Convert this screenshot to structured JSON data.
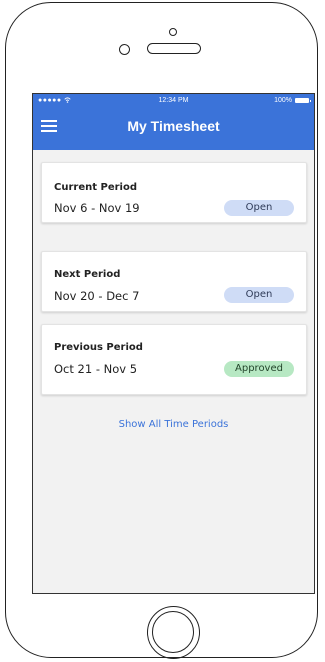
{
  "status_bar": {
    "signal": "●●●●● ",
    "wifi_icon": "wifi-icon",
    "time": "12:34 PM",
    "battery_percent": "100%"
  },
  "app_bar": {
    "menu_icon": "hamburger-menu-icon",
    "title": "My Timesheet"
  },
  "periods": [
    {
      "label": "Current Period",
      "dates": "Nov 6 - Nov 19",
      "status": "Open"
    },
    {
      "label": "Next Period",
      "dates": "Nov 20 - Dec 7",
      "status": "Open"
    },
    {
      "label": "Previous Period",
      "dates": "Oct 21 - Nov 5",
      "status": "Approved"
    }
  ],
  "show_all_label": "Show All Time Periods",
  "colors": {
    "primary": "#3b73d9",
    "open_badge": "#cfdcf6",
    "approved_badge": "#b7e8c3"
  }
}
